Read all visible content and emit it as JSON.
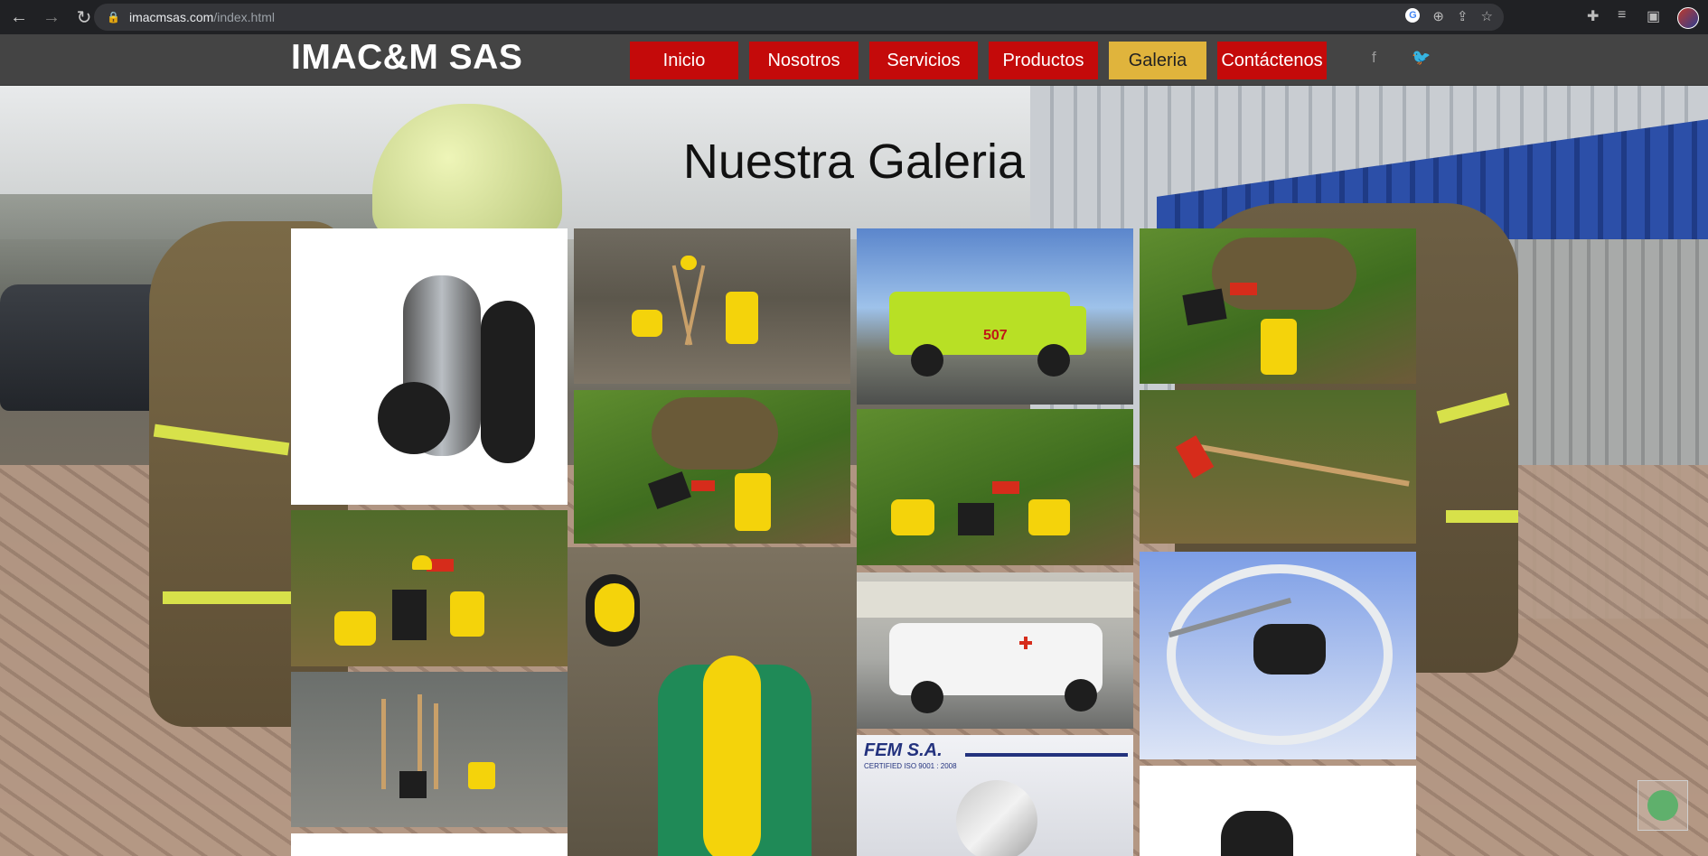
{
  "browser": {
    "url_domain": "imacmsas.com",
    "url_path": "/index.html"
  },
  "site": {
    "logo": "IMAC&M SAS",
    "menu": [
      {
        "label": "Inicio",
        "active": false
      },
      {
        "label": "Nosotros",
        "active": false
      },
      {
        "label": "Servicios",
        "active": false
      },
      {
        "label": "Productos",
        "active": false
      },
      {
        "label": "Galeria",
        "active": true
      },
      {
        "label": "Contáctenos",
        "active": false
      }
    ],
    "social": [
      "facebook-icon",
      "twitter-icon"
    ],
    "colors": {
      "menu": "#c40a0a",
      "menu_active": "#e0b43c",
      "header": "#444444"
    }
  },
  "page": {
    "heading": "Nuestra Galeria"
  },
  "gallery": {
    "items": [
      {
        "name": "gallery-image-scba-mask"
      },
      {
        "name": "gallery-image-forest-tools"
      },
      {
        "name": "gallery-image-fire-truck",
        "truck_number": "507"
      },
      {
        "name": "gallery-image-grass-tools-1"
      },
      {
        "name": "gallery-image-grass-tools-2"
      },
      {
        "name": "gallery-image-grass-tools-3"
      },
      {
        "name": "gallery-image-rake"
      },
      {
        "name": "gallery-image-leaves-tools"
      },
      {
        "name": "gallery-image-scba-back"
      },
      {
        "name": "gallery-image-rescue-pickup"
      },
      {
        "name": "gallery-image-hose-nozzle"
      },
      {
        "name": "gallery-image-cave-tools"
      },
      {
        "name": "gallery-image-fem-suit",
        "brand": "FEM S.A.",
        "brand_sub": "CERTIFIED ISO 9001 : 2008"
      },
      {
        "name": "gallery-image-nozzle"
      },
      {
        "name": "gallery-image-partial"
      }
    ]
  }
}
